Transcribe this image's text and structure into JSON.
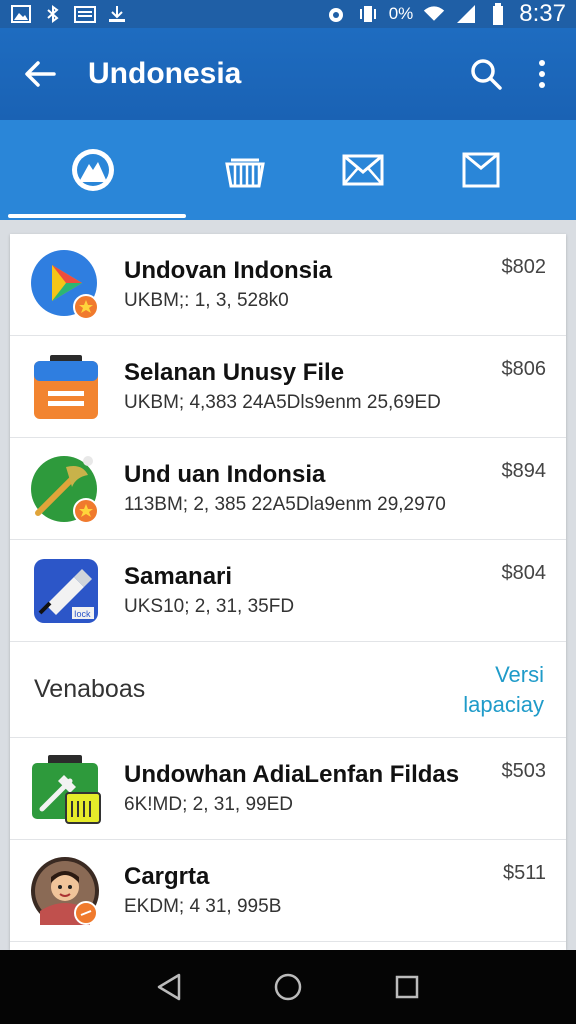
{
  "status_bar": {
    "battery_text": "0%",
    "time": "8:37"
  },
  "app_bar": {
    "title": "Undonesia"
  },
  "tabs": [
    {
      "icon": "chrome-like-icon",
      "selected": true
    },
    {
      "icon": "basket-icon",
      "selected": false
    },
    {
      "icon": "mail-icon",
      "selected": false
    },
    {
      "icon": "envelope-icon",
      "selected": false
    }
  ],
  "items": [
    {
      "title": "Undovan Indonsia",
      "subtitle": "UKBM;: 1, 3, 528k0",
      "price": "$802",
      "icon": "play-store-icon",
      "color": "#2f7ee0"
    },
    {
      "title": "Selanan Unusy File",
      "subtitle": "UKBM; 4,383 24A5Dls9enm 25,69ED",
      "price": "$806",
      "icon": "briefcase-icon",
      "color": "#f28430"
    },
    {
      "title": "Und uan Indonsia",
      "subtitle": "113BM; 2, 385 22A5Dla9enm 29,2970",
      "price": "$894",
      "icon": "tool-icon",
      "color": "#2e9a3c"
    },
    {
      "title": "Samanari",
      "subtitle": "UKS10; 2, 31, 35FD",
      "price": "$804",
      "icon": "usb-icon",
      "color": "#2c56c8"
    }
  ],
  "section": {
    "title": "Venaboas",
    "link_line1": "Versi",
    "link_line2": "lapaciay"
  },
  "items2": [
    {
      "title": "Undowhan AdiaLenfan Fildas",
      "subtitle": "6K!MD; 2, 31, 99ED",
      "price": "$503",
      "icon": "toolbox-icon",
      "color": "#2e9a3c"
    },
    {
      "title": "Cargrta",
      "subtitle": "EKDM; 4 31, 995B",
      "price": "$511",
      "icon": "avatar-icon",
      "color": "#c0504d"
    }
  ]
}
